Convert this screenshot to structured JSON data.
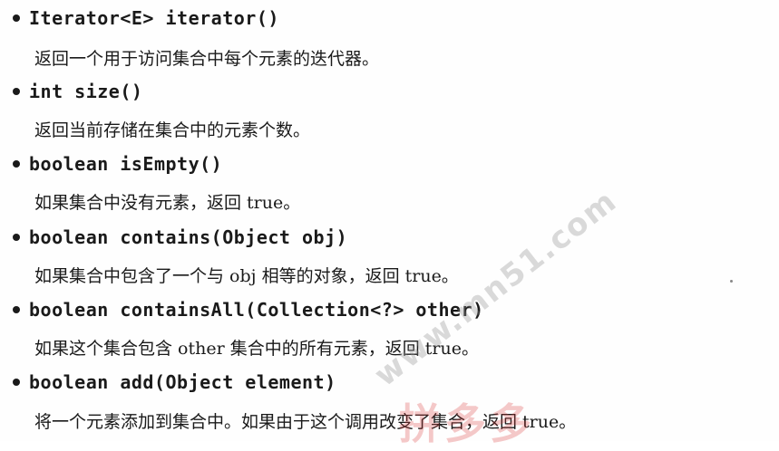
{
  "entries": [
    {
      "signature": "Iterator<E> iterator()",
      "description": "返回一个用于访问集合中每个元素的迭代器。"
    },
    {
      "signature": "int size()",
      "description": "返回当前存储在集合中的元素个数。"
    },
    {
      "signature": "boolean isEmpty()",
      "description": "如果集合中没有元素，返回 true。"
    },
    {
      "signature": "boolean contains(Object obj)",
      "description": "如果集合中包含了一个与 obj 相等的对象，返回 true。"
    },
    {
      "signature": "boolean containsAll(Collection<?> other)",
      "description": "如果这个集合包含 other 集合中的所有元素，返回 true。"
    },
    {
      "signature": "boolean add(Object element)",
      "description": "将一个元素添加到集合中。如果由于这个调用改变了集合，返回 true。"
    }
  ],
  "watermark": {
    "url": "www.mn51.com",
    "logo": "拼多多"
  }
}
